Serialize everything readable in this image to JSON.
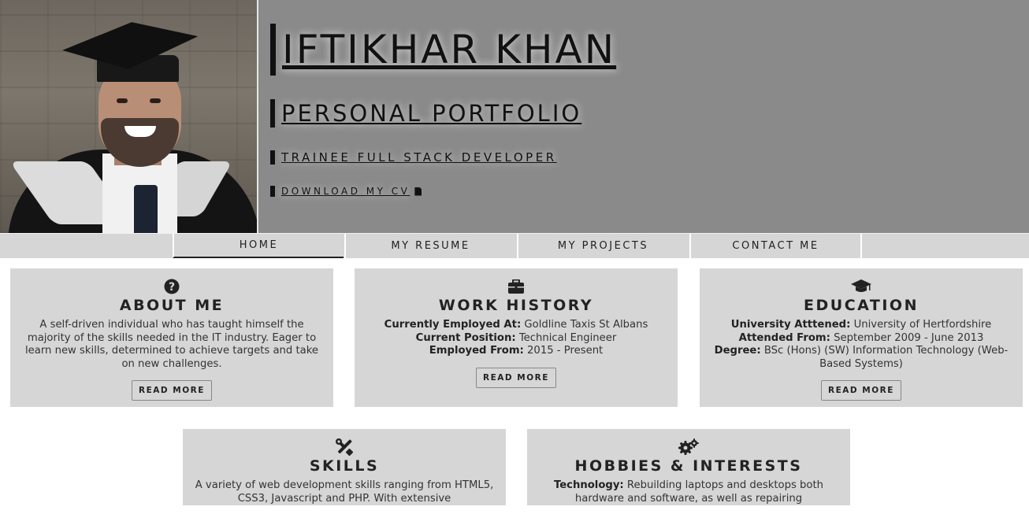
{
  "header": {
    "name": "IFTIKHAR KHAN",
    "subtitle": "PERSONAL PORTFOLIO",
    "role": "TRAINEE FULL STACK DEVELOPER",
    "download_cv": "DOWNLOAD MY CV",
    "background_color": "#8a8a8a"
  },
  "nav": {
    "items": [
      {
        "label": "HOME",
        "active": true
      },
      {
        "label": "MY RESUME",
        "active": false
      },
      {
        "label": "MY PROJECTS",
        "active": false
      },
      {
        "label": "CONTACT ME",
        "active": false
      }
    ]
  },
  "cards": {
    "about": {
      "icon": "question-circle-icon",
      "title": "ABOUT ME",
      "text": "A self-driven individual who has taught himself the majority of the skills needed in the IT industry. Eager to learn new skills, determined to achieve targets and take on new challenges.",
      "button": "READ MORE"
    },
    "work": {
      "icon": "briefcase-icon",
      "title": "WORK HISTORY",
      "rows": [
        {
          "label": "Currently Employed At:",
          "value": "Goldline Taxis St Albans"
        },
        {
          "label": "Current Position:",
          "value": "Technical Engineer"
        },
        {
          "label": "Employed From:",
          "value": "2015 - Present"
        }
      ],
      "button": "READ MORE"
    },
    "education": {
      "icon": "graduation-cap-icon",
      "title": "EDUCATION",
      "rows": [
        {
          "label": "University Atttened:",
          "value": "University of Hertfordshire"
        },
        {
          "label": "Attended From:",
          "value": "September 2009 - June 2013"
        },
        {
          "label": "Degree:",
          "value": "BSc (Hons) (SW) Information Technology (Web-Based Systems)"
        }
      ],
      "button": "READ MORE"
    },
    "skills": {
      "icon": "tools-icon",
      "title": "SKILLS",
      "text": "A variety of web development skills ranging from HTML5, CSS3, Javascript and PHP. With extensive"
    },
    "hobbies": {
      "icon": "gears-icon",
      "title": "HOBBIES & INTERESTS",
      "label": "Technology:",
      "text": "Rebuilding laptops and desktops both hardware and software, as well as repairing"
    }
  },
  "colors": {
    "card_bg": "#d6d6d6",
    "nav_bg": "#d6d6d6",
    "text_dark": "#222222"
  }
}
